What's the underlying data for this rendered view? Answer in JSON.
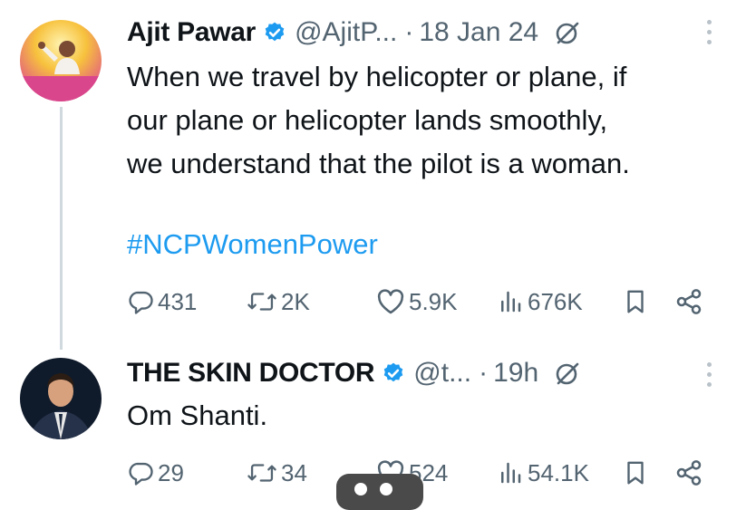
{
  "tweets": [
    {
      "name": "Ajit Pawar",
      "handle": "@AjitP...",
      "separator": "·",
      "time": "18 Jan 24",
      "text_lines": [
        "When we travel by helicopter or plane, if",
        "our plane or helicopter lands smoothly,",
        "we understand that the pilot is a woman."
      ],
      "hashtag": "#NCPWomenPower",
      "stats": {
        "replies": "431",
        "reposts": "2K",
        "likes": "5.9K",
        "views": "676K"
      }
    },
    {
      "name": "THE SKIN DOCTOR",
      "handle": "@t...",
      "separator": "·",
      "time": "19h",
      "text_lines": [
        "Om Shanti."
      ],
      "stats": {
        "replies": "29",
        "reposts": "34",
        "likes": "524",
        "views": "54.1K"
      }
    }
  ],
  "colors": {
    "verified": "#1d9bf0",
    "hashtag": "#1d9bf0",
    "secondary_text": "#536471",
    "thread_line": "#cfd9de"
  },
  "icons": [
    "verified-badge-icon",
    "grok-icon",
    "more-icon",
    "reply-icon",
    "repost-icon",
    "like-icon",
    "views-icon",
    "bookmark-icon",
    "share-icon"
  ]
}
